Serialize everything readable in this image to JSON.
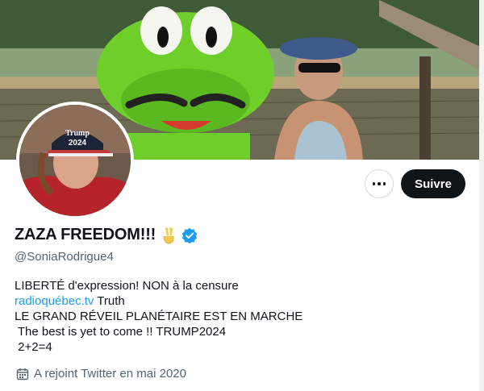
{
  "profile": {
    "display_name": "ZAZA FREEDOM!!!",
    "handle": "@SoniaRodrigue4",
    "bio_line1": "LIBERTÉ d'expression! NON à la censure",
    "bio_link": "radioquébec.tv",
    "bio_link_suffix": " Truth",
    "bio_line3": "LE GRAND RÉVEIL PLANÉTAIRE EST EN MARCHE",
    "bio_line4": " The best is yet to come !! TRUMP2024",
    "bio_line5": " 2+2=4",
    "joined": "A rejoint Twitter en mai 2020"
  },
  "actions": {
    "follow_label": "Suivre"
  },
  "avatar_cap": {
    "line1": "Trump",
    "line2": "2024"
  },
  "icons": {
    "emoji": "victory-hand-emoji",
    "verified": "verified-badge-icon",
    "more": "more-options-icon",
    "calendar": "calendar-icon"
  },
  "colors": {
    "accent": "#1d9bf0",
    "follow_bg": "#0f1419",
    "secondary_text": "#536471"
  }
}
